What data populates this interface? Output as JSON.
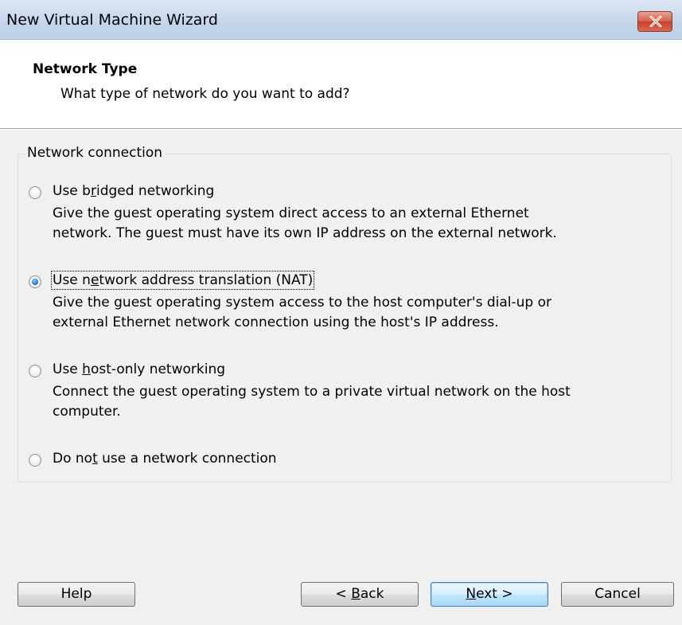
{
  "window": {
    "title": "New Virtual Machine Wizard"
  },
  "header": {
    "title": "Network Type",
    "subtitle": "What type of network do you want to add?"
  },
  "group": {
    "label": "Network connection"
  },
  "options": [
    {
      "label_pre": "Use b",
      "label_mnemonic": "r",
      "label_post": "idged networking",
      "checked": false,
      "description": [
        "Give the guest operating system direct access to an external Ethernet",
        "network. The guest must have its own IP address on the external network."
      ]
    },
    {
      "label_pre": "Use n",
      "label_mnemonic": "e",
      "label_post": "twork address translation (NAT)",
      "checked": true,
      "description": [
        "Give the guest operating system access to the host computer's dial-up or",
        "external Ethernet network connection using the host's IP address."
      ]
    },
    {
      "label_pre": "Use ",
      "label_mnemonic": "h",
      "label_post": "ost-only networking",
      "checked": false,
      "description": [
        "Connect the guest operating system to a private virtual network on the host",
        "computer."
      ]
    },
    {
      "label_pre": "Do no",
      "label_mnemonic": "t",
      "label_post": " use a network connection",
      "checked": false,
      "description": []
    }
  ],
  "buttons": {
    "help": "Help",
    "back_pre": "< ",
    "back_mnemonic": "B",
    "back_post": "ack",
    "next_mnemonic": "N",
    "next_post": "ext >",
    "cancel": "Cancel"
  },
  "colors": {
    "title_bar": "#c4d5ea",
    "close_button": "#c7412a",
    "default_button_border": "#3c7fb1",
    "radio_selected": "#1d76cf"
  }
}
